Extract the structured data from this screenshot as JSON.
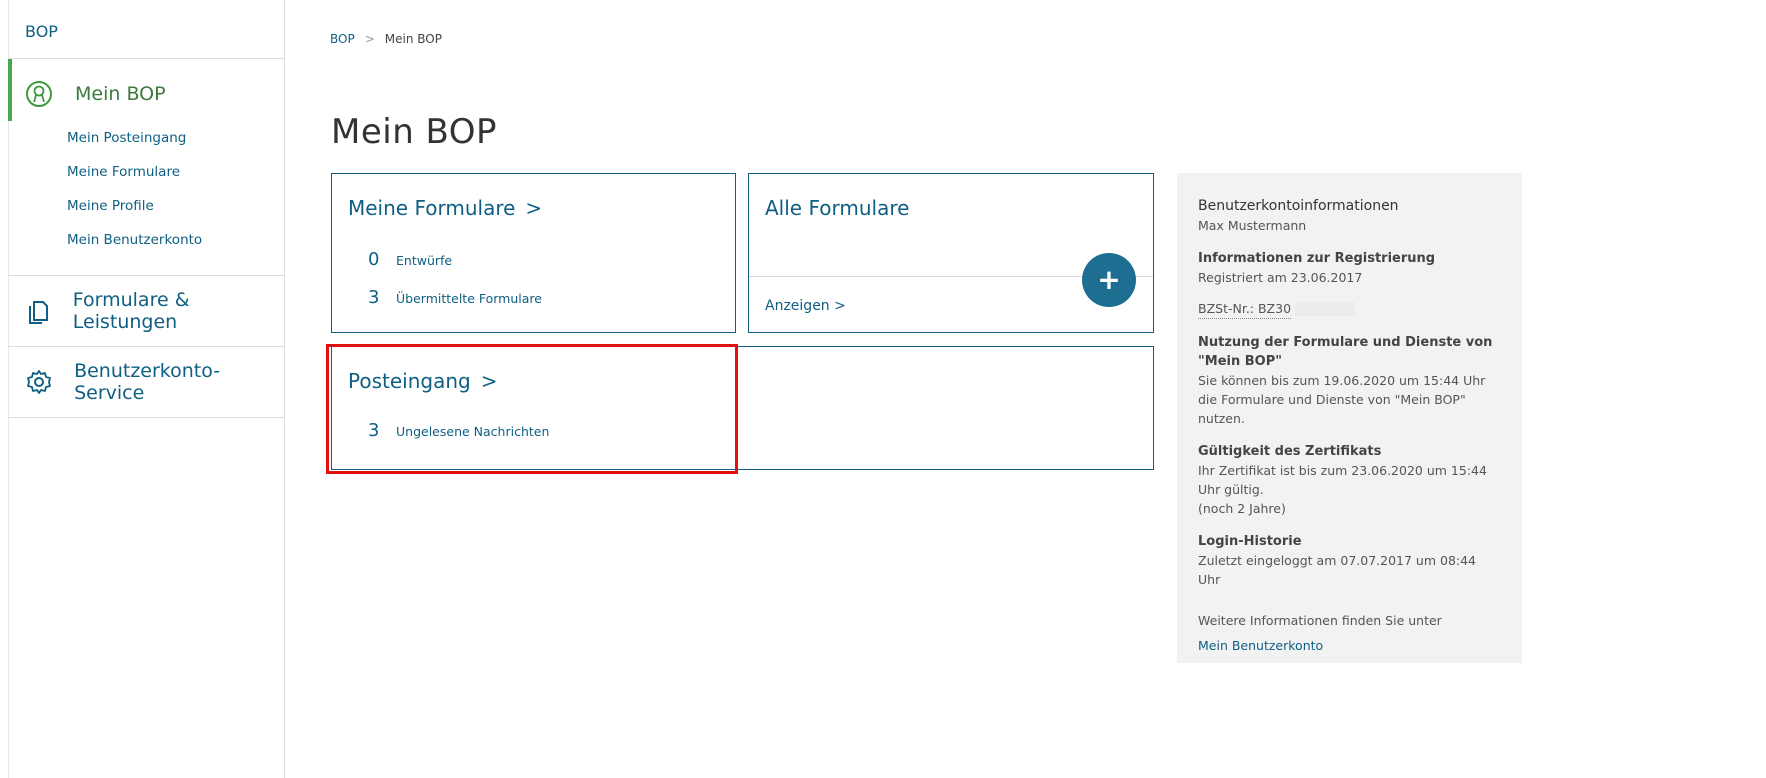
{
  "sidebar": {
    "top_link": "BOP",
    "sections": [
      {
        "label": "Mein BOP",
        "icon": "user-circle-icon",
        "active": true,
        "items": [
          "Mein Posteingang",
          "Meine Formulare",
          "Meine Profile",
          "Mein Benutzerkonto"
        ]
      },
      {
        "label": "Formulare & Leistungen",
        "icon": "copy-documents-icon"
      },
      {
        "label": "Benutzerkonto-Service",
        "icon": "gear-icon"
      }
    ]
  },
  "breadcrumb": {
    "root": "BOP",
    "separator": ">",
    "current": "Mein BOP"
  },
  "page_title": "Mein BOP",
  "cards": {
    "meine_formulare": {
      "title": "Meine Formulare",
      "chevron": ">",
      "rows": [
        {
          "count": "0",
          "label": "Entwürfe"
        },
        {
          "count": "3",
          "label": "Übermittelte Formulare"
        }
      ]
    },
    "alle_formulare": {
      "title": "Alle Formulare",
      "link": "Anzeigen >",
      "plus": "+"
    },
    "posteingang": {
      "title": "Posteingang",
      "chevron": ">",
      "rows": [
        {
          "count": "3",
          "label": "Ungelesene Nachrichten"
        }
      ]
    }
  },
  "info": {
    "title": "Benutzerkontoinformationen",
    "user": "Max Mustermann",
    "reg_title": "Informationen zur Registrierung",
    "reg_text": "Registriert am 23.06.2017",
    "bzst_label": "BZSt-Nr.: BZ30",
    "usage_title": "Nutzung der Formulare und Dienste von \"Mein BOP\"",
    "usage_text": "Sie können bis zum 19.06.2020 um 15:44 Uhr die Formulare und Dienste von \"Mein BOP\" nutzen.",
    "cert_title": "Gültigkeit des Zertifikats",
    "cert_text": "Ihr Zertifikat ist bis zum 23.06.2020 um 15:44 Uhr gültig.",
    "cert_note": "(noch 2 Jahre)",
    "login_title": "Login-Historie",
    "login_text": "Zuletzt eingeloggt am 07.07.2017 um 08:44 Uhr",
    "more_text": "Weitere Informationen finden Sie unter",
    "more_link": "Mein Benutzerkonto"
  },
  "colors": {
    "primary": "#0e5f83",
    "active_green": "#4aa84a",
    "highlight": "#e01010",
    "panel_bg": "#f2f2f2"
  }
}
